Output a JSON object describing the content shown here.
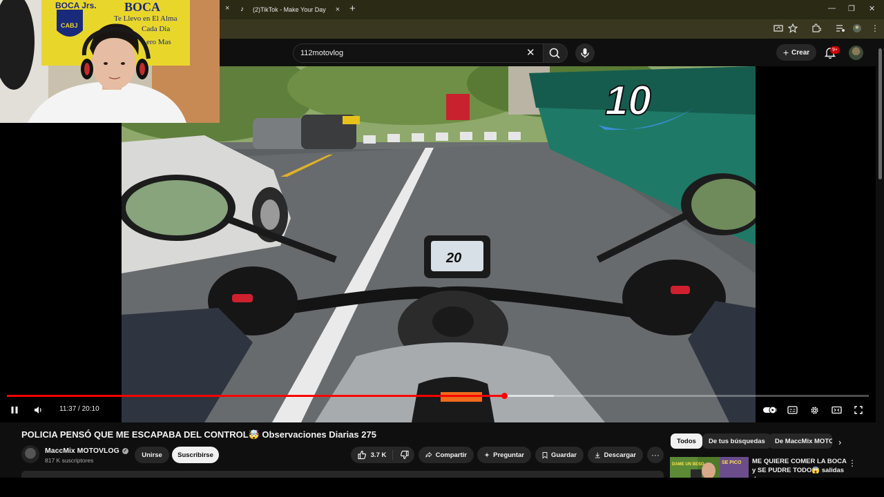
{
  "browser": {
    "tab_title": "(2)TikTok - Make Your Day",
    "tab_close": "×",
    "prev_tab_close": "×",
    "new_tab": "+",
    "win_min": "—",
    "win_restore": "❐",
    "win_close": "✕"
  },
  "youtube": {
    "search_value": "112motovlog",
    "clear_glyph": "✕",
    "create_label": "Crear",
    "create_glyph": "+",
    "notif_badge": "9+"
  },
  "player": {
    "current_time": "11:37",
    "duration": "20:10",
    "time_display": "11:37 / 20:10",
    "progress_fraction": 0.577,
    "buffered_fraction": 0.635,
    "speedometer_reading": "20",
    "bus_number": "10",
    "state": "playing"
  },
  "webcam": {
    "poster_line1": "BOCA Jrs.",
    "poster_line2": "BOCA",
    "poster_line3": "Te Llevo en El Alma",
    "poster_line4": "Cada Dia",
    "poster_line5": "ero Mas",
    "poster_crest": "CABJ"
  },
  "video": {
    "title": "POLICIA PENSÓ QUE ME ESCAPABA DEL CONTROL🤯 Observaciones Diarias 275",
    "channel_name": "MaccMix MOTOVLOG",
    "verified_glyph": "✓",
    "subscribers": "817 K suscriptores",
    "join_label": "Unirse",
    "subscribe_label": "Suscribirse",
    "like_count": "3.7 K",
    "share_label": "Compartir",
    "ask_label": "Preguntar",
    "save_label": "Guardar",
    "download_label": "Descargar",
    "more_glyph": "···"
  },
  "sidebar": {
    "chips": [
      "Todos",
      "De tus búsquedas",
      "De MaccMix MOTO"
    ],
    "next_glyph": "›",
    "recommendation": {
      "title": "ME QUIERE COMER LA BOCA y SE PUDRE TODO😱 salidas de...",
      "thumb_text_1": "DAME UN BESO",
      "thumb_text_2": "SE PICO",
      "menu_glyph": "⋮"
    }
  },
  "colors": {
    "accent_red": "#ff0000",
    "bg": "#0f0f0f",
    "chip_bg": "#272727",
    "chrome_tab_bg": "#2b2a15"
  }
}
